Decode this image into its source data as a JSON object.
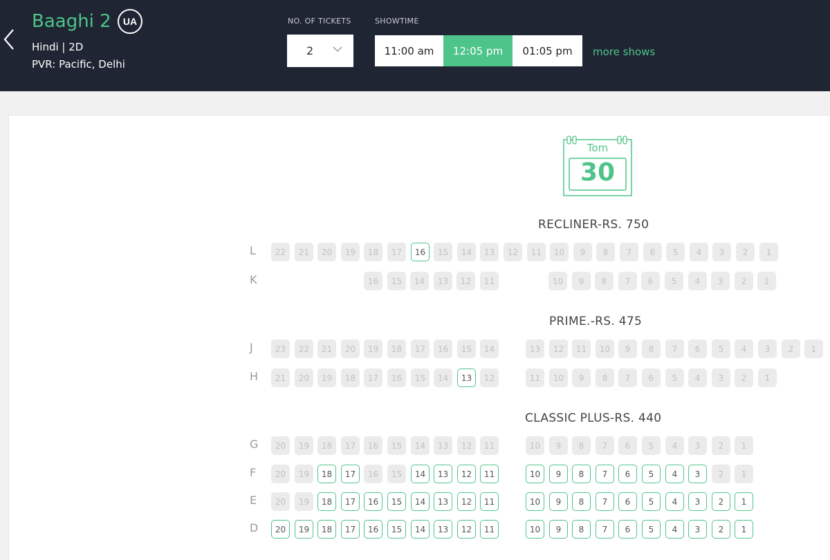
{
  "header": {
    "title": "Baaghi 2",
    "certificate": "UA",
    "language_format": "Hindi | 2D",
    "venue": "PVR: Pacific, Delhi",
    "tickets_label": "NO. OF TICKETS",
    "tickets_value": "2",
    "showtime_label": "SHOWTIME",
    "showtimes": [
      {
        "label": "11:00 am",
        "selected": false
      },
      {
        "label": "12:05 pm",
        "selected": true
      },
      {
        "label": "01:05 pm",
        "selected": false
      }
    ],
    "more_shows": "more shows"
  },
  "date": {
    "day": "Tom",
    "number": "30"
  },
  "colors": {
    "accent": "#4fc48a",
    "header_bg": "#1f2533",
    "sold_bg": "#ebebeb"
  },
  "sections": [
    {
      "label": "RECLINER-RS. 750",
      "rows": [
        {
          "label": "L",
          "groups": [
            {
              "seats": [
                {
                  "n": "22",
                  "s": "sold"
                },
                {
                  "n": "21",
                  "s": "sold"
                },
                {
                  "n": "20",
                  "s": "sold"
                },
                {
                  "n": "19",
                  "s": "sold"
                },
                {
                  "n": "18",
                  "s": "sold"
                },
                {
                  "n": "17",
                  "s": "sold"
                },
                {
                  "n": "16",
                  "s": "avail"
                },
                {
                  "n": "15",
                  "s": "sold"
                },
                {
                  "n": "14",
                  "s": "sold"
                },
                {
                  "n": "13",
                  "s": "sold"
                },
                {
                  "n": "12",
                  "s": "sold"
                },
                {
                  "n": "11",
                  "s": "sold"
                },
                {
                  "n": "10",
                  "s": "sold"
                },
                {
                  "n": "9",
                  "s": "sold"
                },
                {
                  "n": "8",
                  "s": "sold"
                },
                {
                  "n": "7",
                  "s": "sold"
                },
                {
                  "n": "6",
                  "s": "sold"
                },
                {
                  "n": "5",
                  "s": "sold"
                },
                {
                  "n": "4",
                  "s": "sold"
                },
                {
                  "n": "3",
                  "s": "sold"
                },
                {
                  "n": "2",
                  "s": "sold"
                },
                {
                  "n": "1",
                  "s": "sold"
                }
              ]
            }
          ]
        },
        {
          "label": "K",
          "groups": [
            {
              "seats": [
                {
                  "n": "16",
                  "s": "sold"
                },
                {
                  "n": "15",
                  "s": "sold"
                },
                {
                  "n": "14",
                  "s": "sold"
                },
                {
                  "n": "13",
                  "s": "sold"
                },
                {
                  "n": "12",
                  "s": "sold"
                },
                {
                  "n": "11",
                  "s": "sold"
                }
              ]
            },
            {
              "seats": [
                {
                  "n": "10",
                  "s": "sold"
                },
                {
                  "n": "9",
                  "s": "sold"
                },
                {
                  "n": "8",
                  "s": "sold"
                },
                {
                  "n": "7",
                  "s": "sold"
                },
                {
                  "n": "6",
                  "s": "sold"
                },
                {
                  "n": "5",
                  "s": "sold"
                },
                {
                  "n": "4",
                  "s": "sold"
                },
                {
                  "n": "3",
                  "s": "sold"
                },
                {
                  "n": "2",
                  "s": "sold"
                },
                {
                  "n": "1",
                  "s": "sold"
                }
              ]
            }
          ]
        }
      ]
    },
    {
      "label": "PRIME.-RS. 475",
      "rows": [
        {
          "label": "J",
          "groups": [
            {
              "seats": [
                {
                  "n": "23",
                  "s": "sold"
                },
                {
                  "n": "22",
                  "s": "sold"
                },
                {
                  "n": "21",
                  "s": "sold"
                },
                {
                  "n": "20",
                  "s": "sold"
                },
                {
                  "n": "19",
                  "s": "sold"
                },
                {
                  "n": "18",
                  "s": "sold"
                },
                {
                  "n": "17",
                  "s": "sold"
                },
                {
                  "n": "16",
                  "s": "sold"
                },
                {
                  "n": "15",
                  "s": "sold"
                },
                {
                  "n": "14",
                  "s": "sold"
                }
              ]
            },
            {
              "seats": [
                {
                  "n": "13",
                  "s": "sold"
                },
                {
                  "n": "12",
                  "s": "sold"
                },
                {
                  "n": "11",
                  "s": "sold"
                },
                {
                  "n": "10",
                  "s": "sold"
                },
                {
                  "n": "9",
                  "s": "sold"
                },
                {
                  "n": "8",
                  "s": "sold"
                },
                {
                  "n": "7",
                  "s": "sold"
                },
                {
                  "n": "6",
                  "s": "sold"
                },
                {
                  "n": "5",
                  "s": "sold"
                },
                {
                  "n": "4",
                  "s": "sold"
                },
                {
                  "n": "3",
                  "s": "sold"
                },
                {
                  "n": "2",
                  "s": "sold"
                },
                {
                  "n": "1",
                  "s": "sold"
                }
              ]
            }
          ]
        },
        {
          "label": "H",
          "groups": [
            {
              "seats": [
                {
                  "n": "21",
                  "s": "sold"
                },
                {
                  "n": "20",
                  "s": "sold"
                },
                {
                  "n": "19",
                  "s": "sold"
                },
                {
                  "n": "18",
                  "s": "sold"
                },
                {
                  "n": "17",
                  "s": "sold"
                },
                {
                  "n": "16",
                  "s": "sold"
                },
                {
                  "n": "15",
                  "s": "sold"
                },
                {
                  "n": "14",
                  "s": "sold"
                },
                {
                  "n": "13",
                  "s": "avail"
                },
                {
                  "n": "12",
                  "s": "sold"
                }
              ]
            },
            {
              "seats": [
                {
                  "n": "11",
                  "s": "sold"
                },
                {
                  "n": "10",
                  "s": "sold"
                },
                {
                  "n": "9",
                  "s": "sold"
                },
                {
                  "n": "8",
                  "s": "sold"
                },
                {
                  "n": "7",
                  "s": "sold"
                },
                {
                  "n": "6",
                  "s": "sold"
                },
                {
                  "n": "5",
                  "s": "sold"
                },
                {
                  "n": "4",
                  "s": "sold"
                },
                {
                  "n": "3",
                  "s": "sold"
                },
                {
                  "n": "2",
                  "s": "sold"
                },
                {
                  "n": "1",
                  "s": "sold"
                }
              ]
            }
          ]
        }
      ]
    },
    {
      "label": "CLASSIC PLUS-RS. 440",
      "rows": [
        {
          "label": "G",
          "groups": [
            {
              "seats": [
                {
                  "n": "20",
                  "s": "sold"
                },
                {
                  "n": "19",
                  "s": "sold"
                },
                {
                  "n": "18",
                  "s": "sold"
                },
                {
                  "n": "17",
                  "s": "sold"
                },
                {
                  "n": "16",
                  "s": "sold"
                },
                {
                  "n": "15",
                  "s": "sold"
                },
                {
                  "n": "14",
                  "s": "sold"
                },
                {
                  "n": "13",
                  "s": "sold"
                },
                {
                  "n": "12",
                  "s": "sold"
                },
                {
                  "n": "11",
                  "s": "sold"
                }
              ]
            },
            {
              "seats": [
                {
                  "n": "10",
                  "s": "sold"
                },
                {
                  "n": "9",
                  "s": "sold"
                },
                {
                  "n": "8",
                  "s": "sold"
                },
                {
                  "n": "7",
                  "s": "sold"
                },
                {
                  "n": "6",
                  "s": "sold"
                },
                {
                  "n": "5",
                  "s": "sold"
                },
                {
                  "n": "4",
                  "s": "sold"
                },
                {
                  "n": "3",
                  "s": "sold"
                },
                {
                  "n": "2",
                  "s": "sold"
                },
                {
                  "n": "1",
                  "s": "sold"
                }
              ]
            }
          ]
        },
        {
          "label": "F",
          "groups": [
            {
              "seats": [
                {
                  "n": "20",
                  "s": "sold"
                },
                {
                  "n": "19",
                  "s": "sold"
                },
                {
                  "n": "18",
                  "s": "avail"
                },
                {
                  "n": "17",
                  "s": "avail"
                },
                {
                  "n": "16",
                  "s": "sold"
                },
                {
                  "n": "15",
                  "s": "sold"
                },
                {
                  "n": "14",
                  "s": "avail"
                },
                {
                  "n": "13",
                  "s": "avail"
                },
                {
                  "n": "12",
                  "s": "avail"
                },
                {
                  "n": "11",
                  "s": "avail"
                }
              ]
            },
            {
              "seats": [
                {
                  "n": "10",
                  "s": "avail"
                },
                {
                  "n": "9",
                  "s": "avail"
                },
                {
                  "n": "8",
                  "s": "avail"
                },
                {
                  "n": "7",
                  "s": "avail"
                },
                {
                  "n": "6",
                  "s": "avail"
                },
                {
                  "n": "5",
                  "s": "avail"
                },
                {
                  "n": "4",
                  "s": "avail"
                },
                {
                  "n": "3",
                  "s": "avail"
                },
                {
                  "n": "2",
                  "s": "sold"
                },
                {
                  "n": "1",
                  "s": "sold"
                }
              ]
            }
          ]
        },
        {
          "label": "E",
          "groups": [
            {
              "seats": [
                {
                  "n": "20",
                  "s": "sold"
                },
                {
                  "n": "19",
                  "s": "sold"
                },
                {
                  "n": "18",
                  "s": "avail"
                },
                {
                  "n": "17",
                  "s": "avail"
                },
                {
                  "n": "16",
                  "s": "avail"
                },
                {
                  "n": "15",
                  "s": "avail"
                },
                {
                  "n": "14",
                  "s": "avail"
                },
                {
                  "n": "13",
                  "s": "avail"
                },
                {
                  "n": "12",
                  "s": "avail"
                },
                {
                  "n": "11",
                  "s": "avail"
                }
              ]
            },
            {
              "seats": [
                {
                  "n": "10",
                  "s": "avail"
                },
                {
                  "n": "9",
                  "s": "avail"
                },
                {
                  "n": "8",
                  "s": "avail"
                },
                {
                  "n": "7",
                  "s": "avail"
                },
                {
                  "n": "6",
                  "s": "avail"
                },
                {
                  "n": "5",
                  "s": "avail"
                },
                {
                  "n": "4",
                  "s": "avail"
                },
                {
                  "n": "3",
                  "s": "avail"
                },
                {
                  "n": "2",
                  "s": "avail"
                },
                {
                  "n": "1",
                  "s": "avail"
                }
              ]
            }
          ]
        },
        {
          "label": "D",
          "groups": [
            {
              "seats": [
                {
                  "n": "20",
                  "s": "avail"
                },
                {
                  "n": "19",
                  "s": "avail"
                },
                {
                  "n": "18",
                  "s": "avail"
                },
                {
                  "n": "17",
                  "s": "avail"
                },
                {
                  "n": "16",
                  "s": "avail"
                },
                {
                  "n": "15",
                  "s": "avail"
                },
                {
                  "n": "14",
                  "s": "avail"
                },
                {
                  "n": "13",
                  "s": "avail"
                },
                {
                  "n": "12",
                  "s": "avail"
                },
                {
                  "n": "11",
                  "s": "avail"
                }
              ]
            },
            {
              "seats": [
                {
                  "n": "10",
                  "s": "avail"
                },
                {
                  "n": "9",
                  "s": "avail"
                },
                {
                  "n": "8",
                  "s": "avail"
                },
                {
                  "n": "7",
                  "s": "avail"
                },
                {
                  "n": "6",
                  "s": "avail"
                },
                {
                  "n": "5",
                  "s": "avail"
                },
                {
                  "n": "4",
                  "s": "avail"
                },
                {
                  "n": "3",
                  "s": "avail"
                },
                {
                  "n": "2",
                  "s": "avail"
                },
                {
                  "n": "1",
                  "s": "avail"
                }
              ]
            }
          ]
        }
      ]
    }
  ]
}
